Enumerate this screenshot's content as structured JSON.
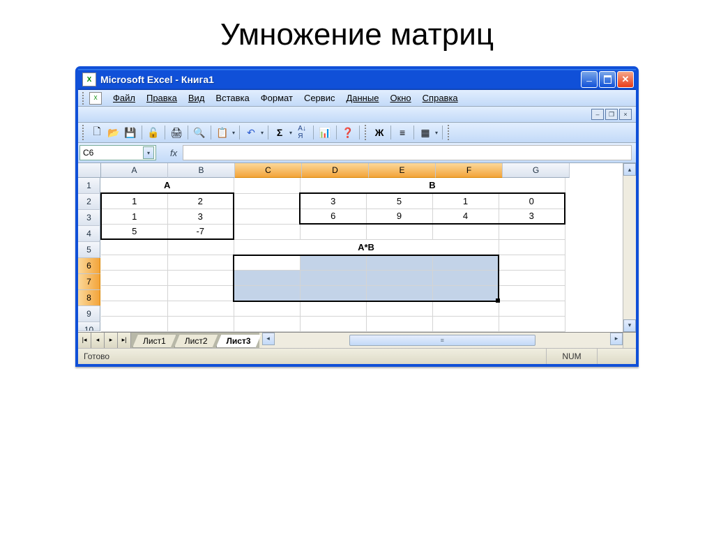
{
  "slide": {
    "title": "Умножение матриц"
  },
  "window": {
    "title": "Microsoft Excel - Книга1"
  },
  "menu": {
    "file": "Файл",
    "edit": "Правка",
    "view": "Вид",
    "insert": "Вставка",
    "format": "Формат",
    "tools": "Сервис",
    "data": "Данные",
    "window_m": "Окно",
    "help": "Справка"
  },
  "toolbar": {
    "bold": "Ж"
  },
  "formula": {
    "name_box": "C6",
    "fx": "fx",
    "value": ""
  },
  "columns": [
    "A",
    "B",
    "C",
    "D",
    "E",
    "F",
    "G"
  ],
  "rows": [
    "1",
    "2",
    "3",
    "4",
    "5",
    "6",
    "7",
    "8",
    "9",
    "10"
  ],
  "labels": {
    "matrixA": "A",
    "matrixB": "B",
    "result": "A*B"
  },
  "matrixA": [
    [
      "1",
      "2"
    ],
    [
      "1",
      "3"
    ],
    [
      "5",
      "-7"
    ]
  ],
  "matrixB": [
    [
      "3",
      "5",
      "1",
      "0"
    ],
    [
      "6",
      "9",
      "4",
      "3"
    ]
  ],
  "sheets": {
    "s1": "Лист1",
    "s2": "Лист2",
    "s3": "Лист3"
  },
  "status": {
    "ready": "Готово",
    "num": "NUM"
  },
  "selected_columns": [
    "C",
    "D",
    "E",
    "F"
  ],
  "selected_rows": [
    "6",
    "7",
    "8"
  ],
  "active_cell": "C6"
}
